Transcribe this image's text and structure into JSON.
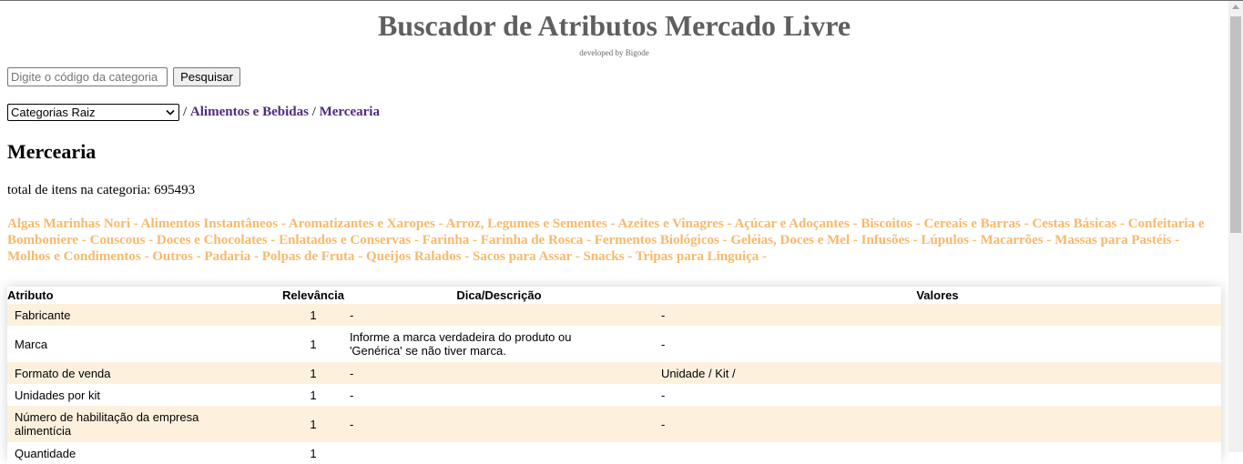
{
  "header": {
    "title": "Buscador de Atributos Mercado Livre",
    "subtitle": "developed by Bigode"
  },
  "search": {
    "placeholder": "Digite o código da categoria",
    "value": "",
    "button_label": "Pesquisar"
  },
  "breadcrumb": {
    "select_value": "Categorias Raiz",
    "sep1": " / ",
    "item1": "Alimentos e Bebidas",
    "sep2": " / ",
    "item2": "Mercearia"
  },
  "category": {
    "name": "Mercearia",
    "total_text": "total de itens na categoria: 695493"
  },
  "subcategories": [
    "Algas Marinhas Nori",
    "Alimentos Instantâneos",
    "Aromatizantes e Xaropes",
    "Arroz, Legumes e Sementes",
    "Azeites e Vinagres",
    "Açúcar e Adoçantes",
    "Biscoitos",
    "Cereais e Barras",
    "Cestas Básicas",
    "Confeitaria e Bomboniere",
    "Couscous",
    "Doces e Chocolates",
    "Enlatados e Conservas",
    "Farinha",
    "Farinha de Rosca",
    "Fermentos Biológicos",
    "Geléias, Doces e Mel",
    "Infusões",
    "Lúpulos",
    "Macarrões",
    "Massas para Pastéis",
    "Molhos e Condimentos",
    "Outros",
    "Padaria",
    "Polpas de Fruta",
    "Queijos Ralados",
    "Sacos para Assar",
    "Snacks",
    "Tripas para Linguiça"
  ],
  "subcategory_separator": " - ",
  "colors": {
    "subcategory_link": "#f7b96b",
    "breadcrumb_link": "#4e2b7e",
    "row_alt": "#fdf1de",
    "title": "#5f5f5f"
  },
  "table": {
    "headers": {
      "attribute": "Atributo",
      "relevance": "Relevância",
      "hint": "Dica/Descrição",
      "values": "Valores"
    },
    "rows": [
      {
        "attribute": "Fabricante",
        "relevance": "1",
        "hint": "-",
        "values": "-"
      },
      {
        "attribute": "Marca",
        "relevance": "1",
        "hint": "Informe a marca verdadeira do produto ou 'Genérica' se não tiver marca.",
        "values": "-"
      },
      {
        "attribute": "Formato de venda",
        "relevance": "1",
        "hint": "-",
        "values": "Unidade / Kit /"
      },
      {
        "attribute": "Unidades por kit",
        "relevance": "1",
        "hint": "-",
        "values": "-"
      },
      {
        "attribute": "Número de habilitação da empresa alimentícia",
        "relevance": "1",
        "hint": "-",
        "values": "-"
      },
      {
        "attribute": "Quantidade",
        "relevance": "1",
        "hint": "",
        "values": ""
      }
    ]
  }
}
